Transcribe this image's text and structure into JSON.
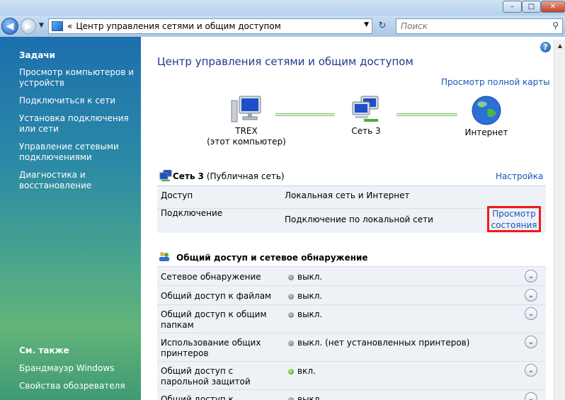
{
  "window": {
    "controls": {
      "minimize": "–",
      "maximize": "□",
      "close": "✕"
    }
  },
  "navbar": {
    "back_glyph": "◀",
    "forward_glyph": "▶",
    "history_glyph": "▼",
    "breadcrumb_chevron": "«",
    "address": "Центр управления сетями и общим доступом",
    "address_dropdown": "▼",
    "refresh_glyph": "↻",
    "search_placeholder": "Поиск",
    "search_glyph": "⚲"
  },
  "sidebar": {
    "tasks_header": "Задачи",
    "tasks": [
      "Просмотр компьютеров и устройств",
      "Подключиться к сети",
      "Установка подключения или сети",
      "Управление сетевыми подключениями",
      "Диагностика и восстановление"
    ],
    "see_also_header": "См. также",
    "see_also": [
      "Брандмауэр Windows",
      "Свойства обозревателя"
    ]
  },
  "main": {
    "help_glyph": "?",
    "title": "Центр управления сетями и общим доступом",
    "full_map_link": "Просмотр полной карты",
    "map": {
      "computer_name": "TREX",
      "computer_sub": "(этот компьютер)",
      "network_name": "Сеть 3",
      "internet_name": "Интернет"
    },
    "network": {
      "name": "Сеть  3",
      "type": "(Публичная сеть)",
      "settings_link": "Настройка",
      "access_label": "Доступ",
      "access_value": "Локальная сеть и Интернет",
      "connection_label": "Подключение",
      "connection_value": "Подключение по локальной сети",
      "status_link_line1": "Просмотр",
      "status_link_line2": "состояния"
    },
    "sharing": {
      "title": "Общий доступ и сетевое обнаружение",
      "rows": [
        {
          "label": "Сетевое обнаружение",
          "value": "выкл.",
          "state": "off"
        },
        {
          "label": "Общий доступ к файлам",
          "value": "выкл.",
          "state": "off"
        },
        {
          "label": "Общий доступ к общим папкам",
          "value": "выкл.",
          "state": "off"
        },
        {
          "label": "Использование общих принтеров",
          "value": "выкл. (нет установленных принтеров)",
          "state": "off"
        },
        {
          "label": "Общий доступ с парольной защитой",
          "value": "вкл.",
          "state": "on"
        },
        {
          "label": "Общий доступ к медиафайлам",
          "value": "выкл.",
          "state": "off"
        }
      ],
      "expand_glyph": "⌄"
    }
  },
  "colors": {
    "link": "#1a55b8",
    "title": "#1e3a8a",
    "highlight_box": "#f01a1a",
    "status_on": "#2f9a17",
    "status_off": "#6d6d6d"
  }
}
